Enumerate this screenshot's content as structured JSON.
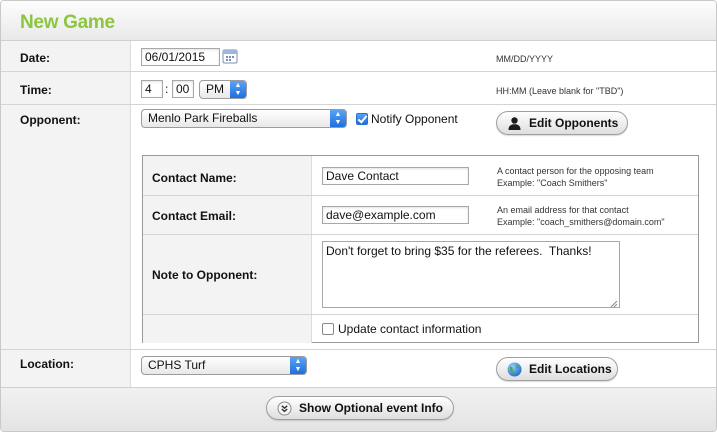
{
  "title": "New Game",
  "date": {
    "label": "Date:",
    "value": "06/01/2015",
    "hint": "MM/DD/YYYY"
  },
  "time": {
    "label": "Time:",
    "hour": "4",
    "separator": ":",
    "minute": "00",
    "ampm": "PM",
    "hint": "HH:MM (Leave blank for \"TBD\")"
  },
  "opponent": {
    "label": "Opponent:",
    "selected": "Menlo Park Fireballs",
    "notify_label": "Notify Opponent",
    "notify_checked": true,
    "edit_button": "Edit Opponents",
    "contact": {
      "name_label": "Contact Name:",
      "name_value": "Dave Contact",
      "name_hint_1": "A contact person for the opposing team",
      "name_hint_2": "Example: \"Coach Smithers\"",
      "email_label": "Contact Email:",
      "email_value": "dave@example.com",
      "email_hint_1": "An email address for that contact",
      "email_hint_2": "Example: \"coach_smithers@domain.com\"",
      "note_label": "Note to Opponent:",
      "note_value": "Don't forget to bring $35 for the referees.  Thanks!",
      "update_label": "Update contact information",
      "update_checked": false
    }
  },
  "location": {
    "label": "Location:",
    "selected": "CPHS Turf",
    "edit_button": "Edit Locations"
  },
  "footer": {
    "optional_button": "Show Optional event Info"
  },
  "icons": {
    "calendar": "calendar-icon",
    "person": "person-icon",
    "globe": "globe-icon",
    "chevron_double_down": "chevron-double-down-icon",
    "select_arrows": "select-arrows-icon"
  },
  "colors": {
    "title": "#8cc63f",
    "select_accent": "#2f7fe6"
  }
}
